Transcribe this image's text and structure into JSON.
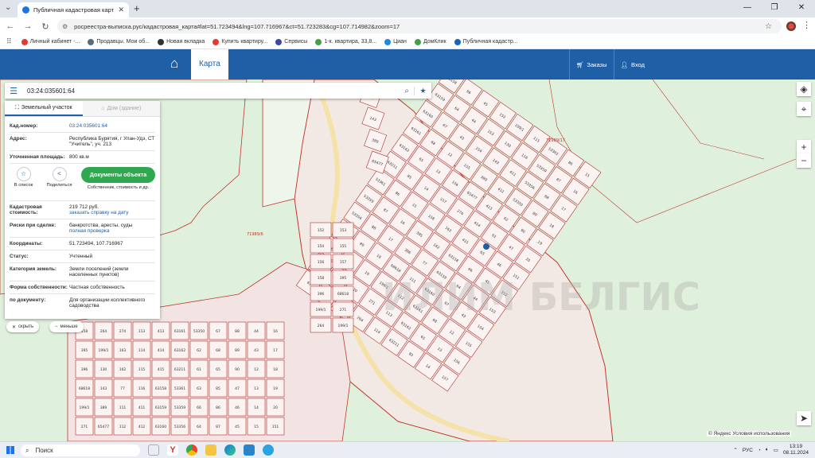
{
  "browser": {
    "tab_title": "Публичная кадастровая карта",
    "url": "росреестра-выписка.рус/кадастровая_карта#lat=51.723494&lng=107.716967&ct=51.723283&cg=107.714982&zoom=17",
    "bookmarks": [
      {
        "label": "Личный кабинет -...",
        "color": "#e53935"
      },
      {
        "label": "Продавцы. Мои об...",
        "color": "#546e7a"
      },
      {
        "label": "Новая вкладка",
        "color": "#333333"
      },
      {
        "label": "Купить квартиру...",
        "color": "#e53935"
      },
      {
        "label": "Сервисы",
        "color": "#3949ab"
      },
      {
        "label": "1-к. квартира, 33,8...",
        "color": "#43a047"
      },
      {
        "label": "Циан",
        "color": "#1e88e5"
      },
      {
        "label": "ДомКлик",
        "color": "#43a047"
      },
      {
        "label": "Публичная кадастр...",
        "color": "#1565c0"
      }
    ]
  },
  "header": {
    "map_tab": "Карта",
    "orders": "Заказы",
    "login": "Вход"
  },
  "search": {
    "value": "03:24:035601:64"
  },
  "panel": {
    "tab_land": "Земельный участок",
    "tab_house": "Дом (здание)",
    "cad_label": "Кад.номер:",
    "cad_value": "03:24:035601:64",
    "address_label": "Адрес:",
    "address_value": "Республика Бурятия, г Улан-Удэ, СТ \"Учитель\", уч. 213",
    "area_label": "Уточненная площадь:",
    "area_value": "800 кв.м",
    "to_list": "В список",
    "share": "Поделиться",
    "docs_button": "Документы объекта",
    "docs_sub": "Собственник, стоимость и др.",
    "cost_label": "Кадастровая стоимость:",
    "cost_value": "219 712 руб.",
    "cost_link": "заказать справку на дату",
    "risks_label": "Риски при сделке:",
    "risks_value": "банкротства, аресты, суды",
    "risks_link": "полная проверка",
    "coords_label": "Координаты:",
    "coords_value": "51.723494, 107.716967",
    "status_label": "Статус:",
    "status_value": "Учтенный",
    "category_label": "Категория земель:",
    "category_value": "Земли поселений (земли населенных пунктов)",
    "ownership_label": "Форма собственности:",
    "ownership_value": "Частная собственность",
    "doc_label": "по документу:",
    "doc_value": "Для организации коллективного садоводства"
  },
  "controls": {
    "hide": "скрыть",
    "less": "меньше"
  },
  "map": {
    "parcel_labels_zone": [
      "71989/6",
      "71989/17"
    ],
    "parcels": [
      "63158",
      "63159",
      "63160",
      "63161",
      "63162",
      "63211",
      "53361",
      "53359",
      "53356",
      "53350",
      "62",
      "61",
      "63",
      "66",
      "64",
      "67",
      "68",
      "65",
      "85",
      "86",
      "87",
      "88",
      "89",
      "90",
      "47",
      "46",
      "45",
      "44",
      "43",
      "12",
      "13",
      "14",
      "15",
      "16",
      "17",
      "18",
      "19",
      "20",
      "151",
      "152",
      "153",
      "154",
      "155",
      "156",
      "157",
      "158",
      "395",
      "396",
      "68618",
      "199/1",
      "271",
      "264",
      "199/1",
      "130",
      "143",
      "389",
      "65477",
      "274",
      "163",
      "162",
      "77",
      "111",
      "112",
      "113",
      "114",
      "115",
      "116",
      "411",
      "412",
      "413",
      "414",
      "415"
    ],
    "watermark": "ИЛИМ БЕЛГИС"
  },
  "copyright": "© Яндекс Условия использования",
  "taskbar": {
    "search": "Поиск",
    "lang": "РУС",
    "time": "13:19",
    "date": "08.11.2024"
  }
}
